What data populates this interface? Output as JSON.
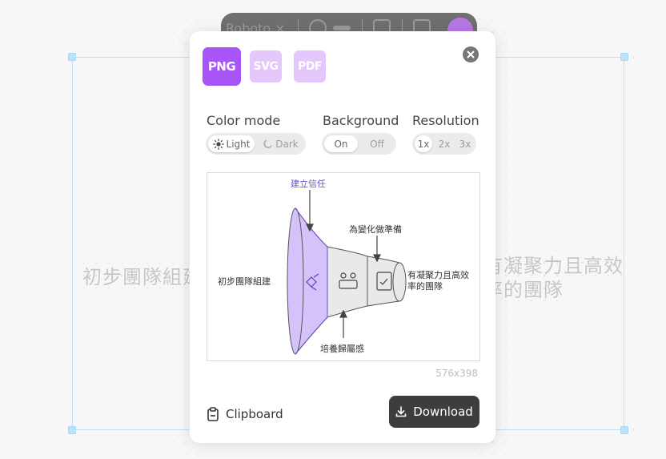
{
  "canvas": {
    "bg_text_left": "初步團隊組建",
    "bg_text_right_line1": "有凝聚力且高效",
    "bg_text_right_line2": "率的團隊"
  },
  "toolbar": {
    "font_label": "Roboto ×"
  },
  "export_dialog": {
    "formats": [
      "PNG",
      "SVG",
      "PDF"
    ],
    "selected_format": "PNG",
    "color_mode": {
      "label": "Color mode",
      "options": [
        "Light",
        "Dark"
      ],
      "selected": "Light"
    },
    "background": {
      "label": "Background",
      "options": [
        "On",
        "Off"
      ],
      "selected": "On"
    },
    "resolution": {
      "label": "Resolution",
      "options": [
        "1x",
        "2x",
        "3x"
      ],
      "selected": "1x"
    },
    "preview": {
      "top_label": "建立信任",
      "upper_label": "為變化做準備",
      "left_label": "初步團隊組建",
      "right_label_line1": "有凝聚力且高效",
      "right_label_line2": "率的團隊",
      "bottom_label": "培養歸屬感"
    },
    "dimensions": "576x398",
    "clipboard_label": "Clipboard",
    "download_label": "Download",
    "colors": {
      "accent": "#a855f7",
      "accent_light": "#e6c7fb",
      "dark_button": "#3d3d3d"
    }
  }
}
